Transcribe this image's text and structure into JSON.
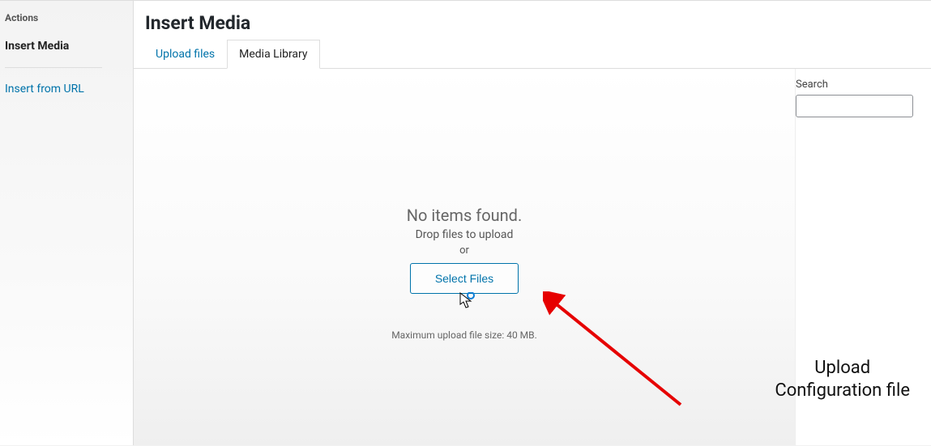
{
  "sidebar": {
    "heading": "Actions",
    "items": [
      {
        "label": "Insert Media",
        "active": true
      },
      {
        "label": "Insert from URL",
        "link": true
      }
    ]
  },
  "header": {
    "title": "Insert Media"
  },
  "tabs": [
    {
      "label": "Upload files",
      "active": false
    },
    {
      "label": "Media Library",
      "active": true
    }
  ],
  "content": {
    "no_items": "No items found.",
    "drop_hint": "Drop files to upload",
    "or": "or",
    "select_files": "Select Files",
    "max_size": "Maximum upload file size: 40 MB."
  },
  "search": {
    "label": "Search",
    "value": ""
  },
  "annotation": {
    "text": "Upload\nConfiguration file"
  }
}
